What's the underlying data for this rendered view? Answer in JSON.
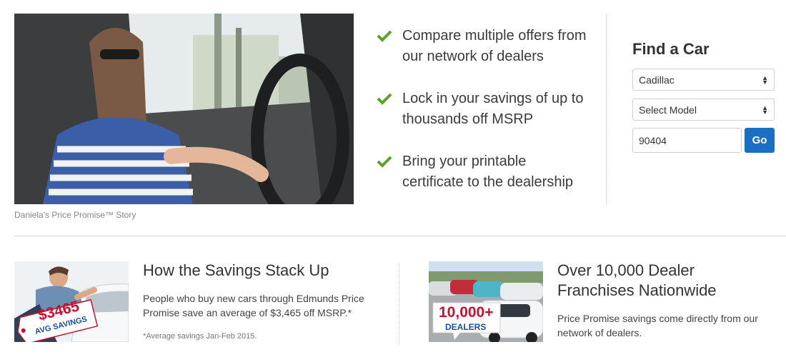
{
  "video": {
    "caption": "Daniela's Price Promise™ Story"
  },
  "benefits": [
    {
      "text": "Compare multiple offers from our network of dealers"
    },
    {
      "text": "Lock in your savings of up to thousands off MSRP"
    },
    {
      "text": "Bring your printable certificate to the dealership"
    }
  ],
  "find_car": {
    "title": "Find a Car",
    "make_selected": "Cadillac",
    "model_selected": "Select Model",
    "zip_value": "90404",
    "go_label": "Go"
  },
  "promos": {
    "savings": {
      "title": "How the Savings Stack Up",
      "body": "People who buy new cars through Edmunds Price Promise save an average of $3,465 off MSRP.*",
      "footnote": "*Average savings Jan-Feb 2015.",
      "badge_amount": "$3465",
      "badge_label": "AVG SAVINGS"
    },
    "dealers": {
      "title": "Over 10,000 Dealer Franchises Nationwide",
      "body": "Price Promise savings come directly from our network of dealers.",
      "badge_count": "10,000+",
      "badge_label": "DEALERS"
    }
  },
  "colors": {
    "check": "#5aa32a",
    "go_button": "#1a6fc4",
    "badge_red": "#c8102e",
    "badge_blue": "#1a4fa0"
  }
}
